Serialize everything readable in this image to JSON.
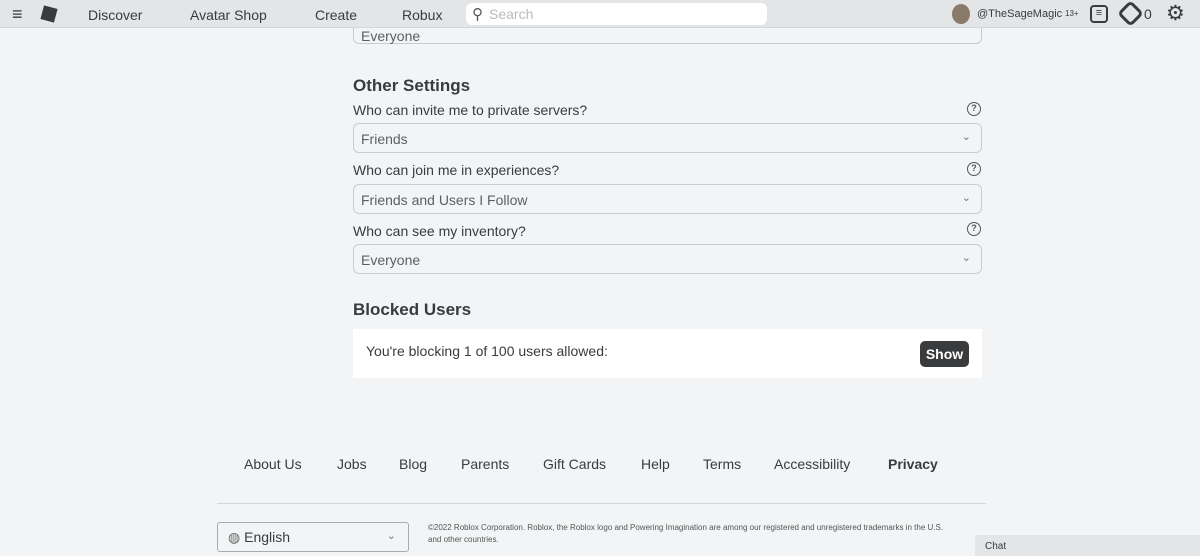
{
  "nav": {
    "items": [
      "Discover",
      "Avatar Shop",
      "Create",
      "Robux"
    ],
    "search_placeholder": "Search",
    "username": "@TheSageMagic",
    "age_badge": "13+",
    "robux_count": "0"
  },
  "settings": {
    "prev_value": "Everyone",
    "other_title": "Other Settings",
    "questions": [
      {
        "label": "Who can invite me to private servers?",
        "value": "Friends"
      },
      {
        "label": "Who can join me in experiences?",
        "value": "Friends and Users I Follow"
      },
      {
        "label": "Who can see my inventory?",
        "value": "Everyone"
      }
    ],
    "blocked_title": "Blocked Users",
    "blocked_text": "You're blocking 1 of 100 users allowed:",
    "show_label": "Show"
  },
  "footer": {
    "links": [
      "About Us",
      "Jobs",
      "Blog",
      "Parents",
      "Gift Cards",
      "Help",
      "Terms",
      "Accessibility",
      "Privacy"
    ],
    "language": "English",
    "copyright": "©2022 Roblox Corporation. Roblox, the Roblox logo and Powering Imagination are among our registered and unregistered trademarks in the U.S. and other countries."
  },
  "chat": {
    "label": "Chat"
  }
}
